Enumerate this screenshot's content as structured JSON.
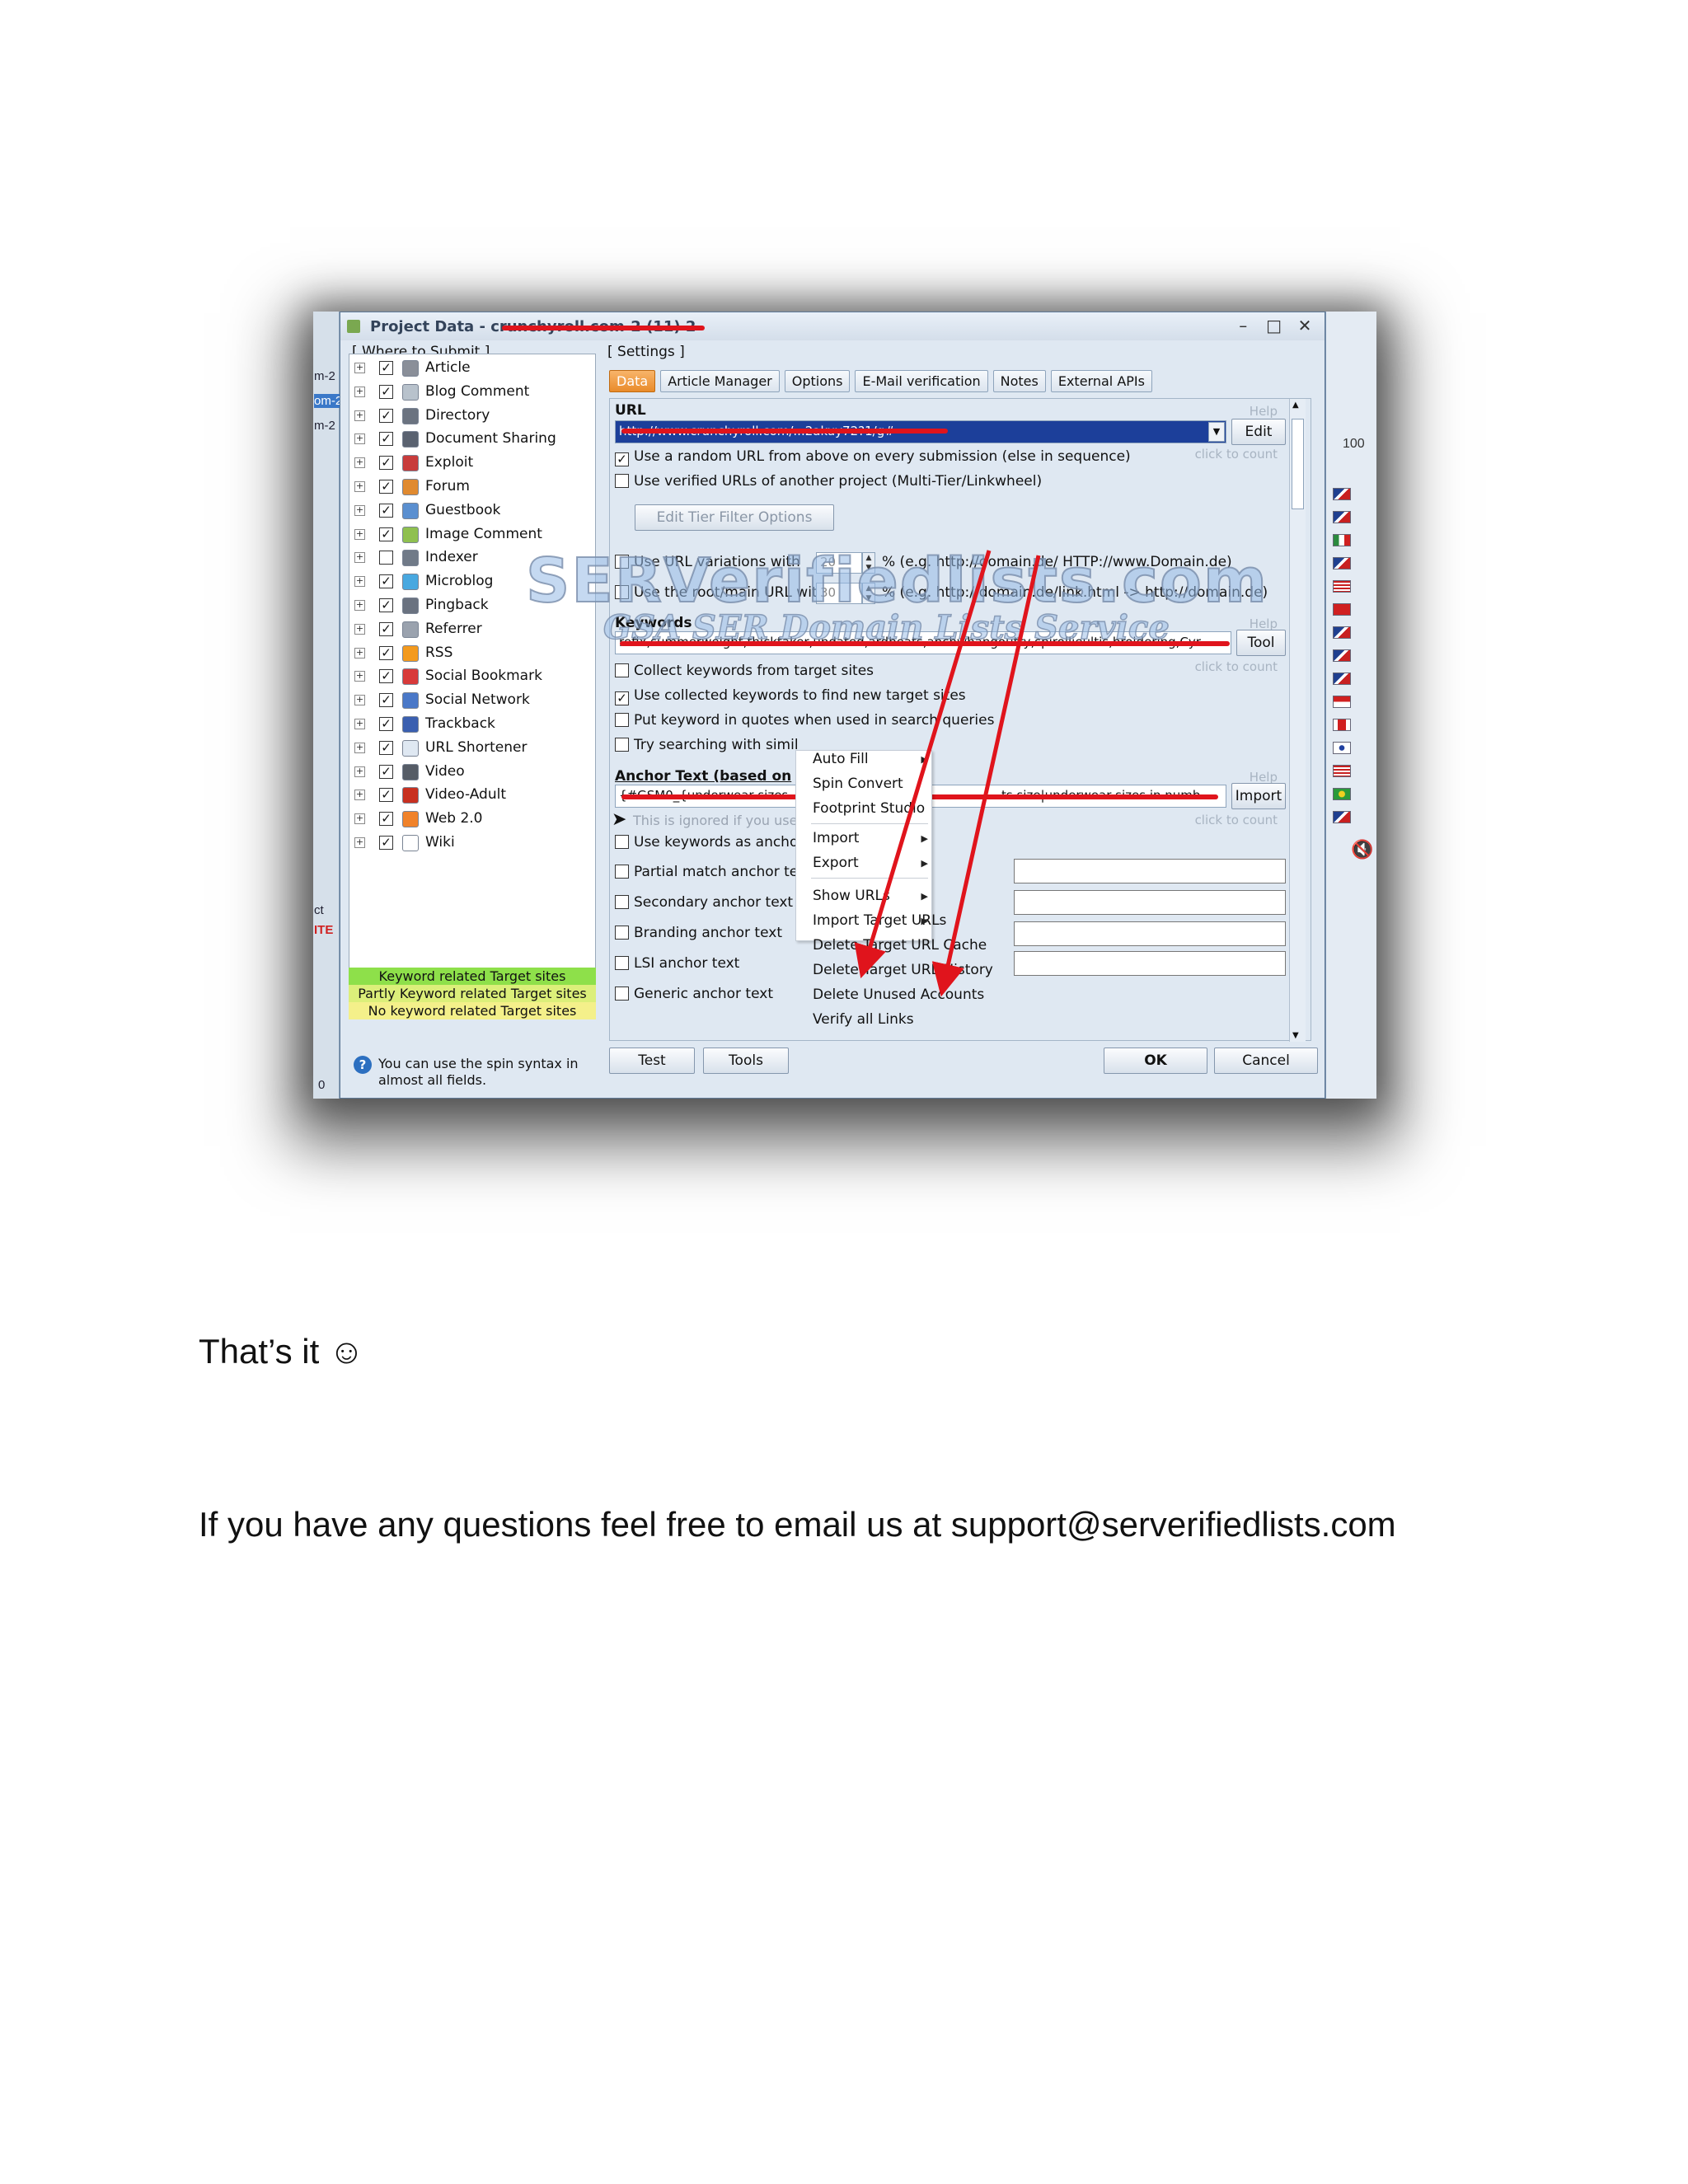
{
  "window": {
    "title": "Project Data - crunchyroll.com-2 (11) 2",
    "controls": [
      "–",
      "□",
      "✕"
    ]
  },
  "background_app": {
    "left_texts": [
      "m-2",
      "om-2",
      "m-2",
      "ct",
      "ITE",
      "0"
    ],
    "right_text": "100"
  },
  "left_panel": {
    "group_title": "[ Where to Submit ]",
    "items": [
      {
        "label": "Article",
        "checked": true,
        "icon": "article-icon",
        "color": "#8a8f99"
      },
      {
        "label": "Blog Comment",
        "checked": true,
        "icon": "speech-bubble-icon",
        "color": "#b8c2cc"
      },
      {
        "label": "Directory",
        "checked": true,
        "icon": "directory-icon",
        "color": "#6b7380"
      },
      {
        "label": "Document Sharing",
        "checked": true,
        "icon": "document-icon",
        "color": "#5a6270"
      },
      {
        "label": "Exploit",
        "checked": true,
        "icon": "bug-icon",
        "color": "#c83c3c"
      },
      {
        "label": "Forum",
        "checked": true,
        "icon": "users-icon",
        "color": "#e08a30"
      },
      {
        "label": "Guestbook",
        "checked": true,
        "icon": "book-icon",
        "color": "#5a8fd0"
      },
      {
        "label": "Image Comment",
        "checked": true,
        "icon": "image-icon",
        "color": "#8fc050"
      },
      {
        "label": "Indexer",
        "checked": false,
        "icon": "indexer-icon",
        "color": "#707a88"
      },
      {
        "label": "Microblog",
        "checked": true,
        "icon": "bird-icon",
        "color": "#48a8e0"
      },
      {
        "label": "Pingback",
        "checked": true,
        "icon": "pingback-icon",
        "color": "#6a7280"
      },
      {
        "label": "Referrer",
        "checked": true,
        "icon": "referrer-icon",
        "color": "#9aa2ae"
      },
      {
        "label": "RSS",
        "checked": true,
        "icon": "rss-icon",
        "color": "#f39a1e"
      },
      {
        "label": "Social Bookmark",
        "checked": true,
        "icon": "heart-icon",
        "color": "#d83a3a"
      },
      {
        "label": "Social Network",
        "checked": true,
        "icon": "network-icon",
        "color": "#4a78c8"
      },
      {
        "label": "Trackback",
        "checked": true,
        "icon": "trackback-icon",
        "color": "#3a5fb0"
      },
      {
        "label": "URL Shortener",
        "checked": true,
        "icon": "double-chevron-icon",
        "color": "#dfe8f2"
      },
      {
        "label": "Video",
        "checked": true,
        "icon": "film-icon",
        "color": "#555c66"
      },
      {
        "label": "Video-Adult",
        "checked": true,
        "icon": "video-adult-icon",
        "color": "#c83020"
      },
      {
        "label": "Web 2.0",
        "checked": true,
        "icon": "blogger-icon",
        "color": "#f0822a"
      },
      {
        "label": "Wiki",
        "checked": true,
        "icon": "wiki-icon",
        "color": "#ffffff"
      }
    ],
    "legend": [
      {
        "text": "Keyword related Target sites",
        "color": "#8ee04a"
      },
      {
        "text": "Partly Keyword related Target sites",
        "color": "#dcef7a"
      },
      {
        "text": "No keyword related Target sites",
        "color": "#f4f08a"
      }
    ],
    "info_text": "You can use the spin syntax in almost all fields."
  },
  "settings": {
    "group_title": "[ Settings ]",
    "tabs": [
      "Data",
      "Article Manager",
      "Options",
      "E-Mail verification",
      "Notes",
      "External APIs"
    ],
    "url": {
      "label": "URL",
      "value": "http://www.crunchyroll.com/...2akuy72?1/g#",
      "help": "Help",
      "edit": "Edit",
      "click_to_count": "click to count"
    },
    "options": {
      "random_url": "Use a random URL from above on every submission (else in sequence)",
      "verified_urls": "Use verified URLs of another project (Multi-Tier/Linkwheel)",
      "edit_tier": "Edit Tier Filter Options",
      "url_variations": "Use URL variations with",
      "url_variations_value": "20",
      "url_variations_note": "% (e.g. http://domain.de/ HTTP://www.Domain.de)",
      "root_url": "Use the root/main URL with",
      "root_url_value": "30",
      "root_url_note": "% (e.g. http://domain.de/link.html -> http://domain.de)"
    },
    "keywords": {
      "label": "Keywords",
      "value": "refix,summerweight,thicktaker,undated,ardbeats,anchwhangoutry,spirollieultis,broidering,Cyr",
      "help": "Help",
      "tool": "Tool",
      "click_to_count": "click to count",
      "collect": "Collect keywords from target sites",
      "use_collected": "Use collected keywords to find new target sites",
      "quotes": "Put keyword in quotes when used in search queries",
      "similar": "Try searching with simil"
    },
    "anchor": {
      "label": "Anchor Text (based on",
      "value": "{#GSM0_{underwear sizes",
      "value_right": "ts size|underwear sizes in numb",
      "help": "Help",
      "import": "Import",
      "click_to_count": "click to count",
      "ignored": "This is ignored if you use a",
      "use_keywords": "Use keywords as ancho",
      "partial": "Partial match anchor te:",
      "secondary": "Secondary anchor text",
      "branding": "Branding anchor text",
      "lsi": "LSI anchor text",
      "generic": "Generic anchor text"
    },
    "buttons": {
      "test": "Test",
      "tools": "Tools",
      "ok": "OK",
      "cancel": "Cancel"
    }
  },
  "context_menu": {
    "items": [
      {
        "label": "Auto Fill",
        "submenu": true
      },
      {
        "label": "Spin Convert",
        "submenu": false
      },
      {
        "label": "Footprint Studio",
        "submenu": false
      },
      {
        "label": "Import",
        "submenu": true
      },
      {
        "label": "Export",
        "submenu": true
      },
      {
        "label": "Show URLs",
        "submenu": true
      },
      {
        "label": "Import Target URLs",
        "submenu": true
      },
      {
        "label": "Delete Target URL Cache",
        "submenu": false
      },
      {
        "label": "Delete Target URL History",
        "submenu": false
      },
      {
        "label": "Delete Unused Accounts",
        "submenu": false
      },
      {
        "label": "Verify all Links",
        "submenu": false
      }
    ]
  },
  "watermark": {
    "main": "SERVerifiedlists.com",
    "sub": "GSA SER Domain Lists Service"
  },
  "annotation_color": "#e0141c",
  "page": {
    "line1": "That’s it ☺",
    "line2": "If you have any questions feel free to email us at support@serverifiedlists.com"
  }
}
